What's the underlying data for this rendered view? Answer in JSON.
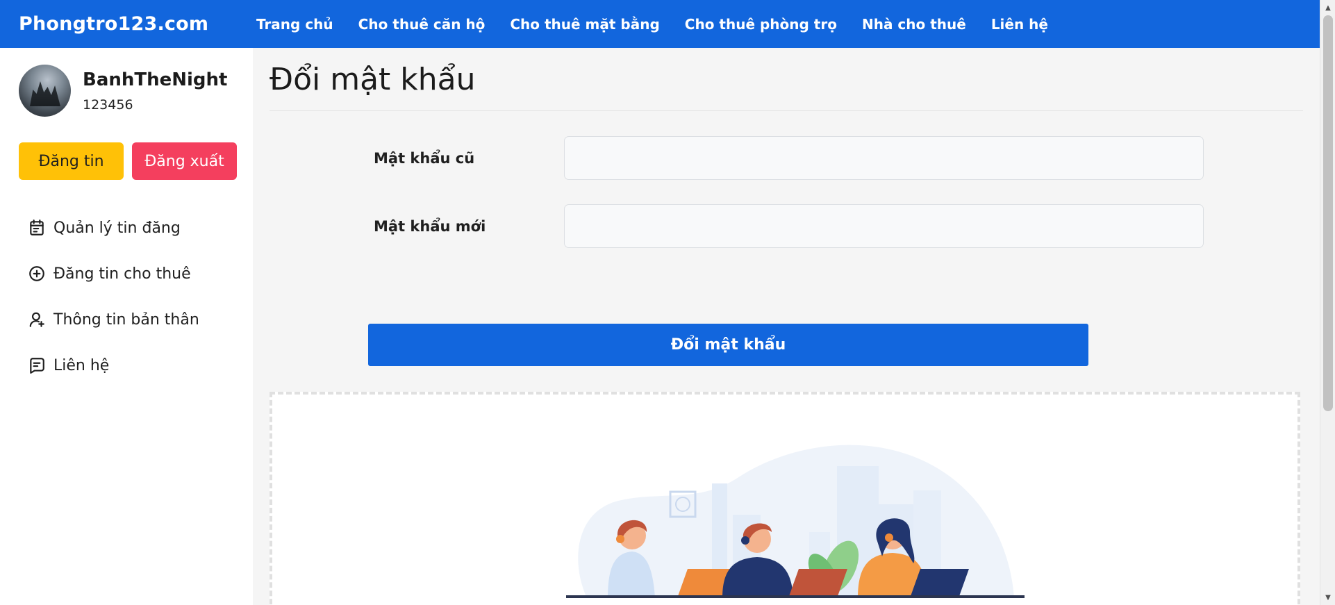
{
  "brand": "Phongtro123.com",
  "nav": [
    "Trang chủ",
    "Cho thuê căn hộ",
    "Cho thuê mặt bằng",
    "Cho thuê phòng trọ",
    "Nhà cho thuê",
    "Liên hệ"
  ],
  "profile": {
    "name": "BanhTheNight",
    "phone": "123456"
  },
  "buttons": {
    "post": "Đăng tin",
    "logout": "Đăng xuất"
  },
  "menu": [
    {
      "label": "Quản lý tin đăng",
      "icon": "calendar-icon"
    },
    {
      "label": "Đăng tin cho thuê",
      "icon": "plus-circle-icon"
    },
    {
      "label": "Thông tin bản thân",
      "icon": "user-plus-icon"
    },
    {
      "label": "Liên hệ",
      "icon": "message-icon"
    }
  ],
  "page": {
    "title": "Đổi mật khẩu",
    "old_password_label": "Mật khẩu cũ",
    "new_password_label": "Mật khẩu mới",
    "old_password_value": "",
    "new_password_value": "",
    "submit_label": "Đổi mật khẩu"
  },
  "colors": {
    "primary": "#1266dd",
    "warning": "#ffc107",
    "danger": "#f43f5e"
  }
}
